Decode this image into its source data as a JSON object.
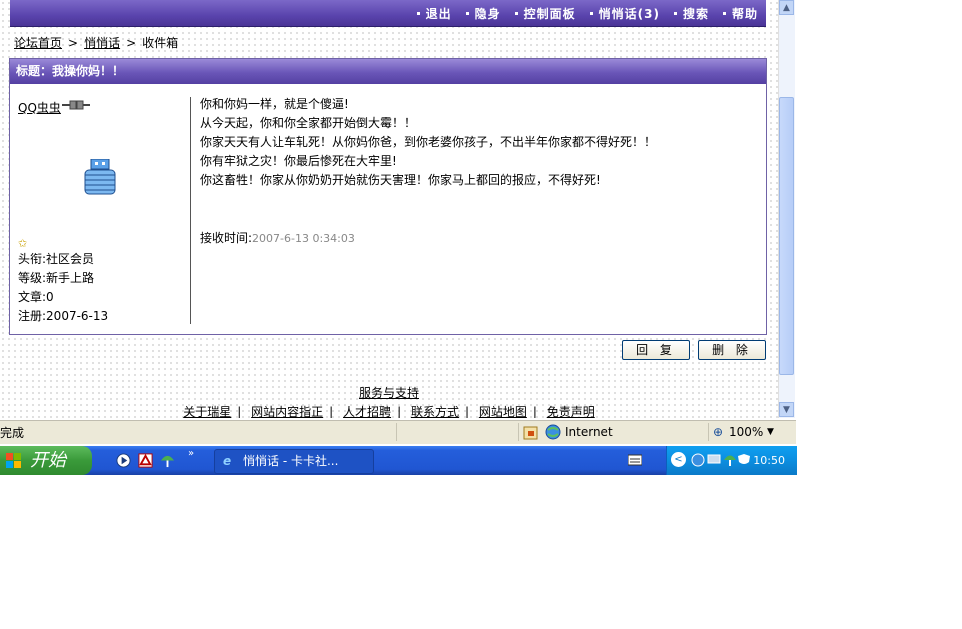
{
  "topnav": {
    "items": [
      "退出",
      "隐身",
      "控制面板",
      "悄悄话(3)",
      "搜索",
      "帮助"
    ]
  },
  "breadcrumb": {
    "home": "论坛首页",
    "whisper": "悄悄话",
    "inbox": "收件箱"
  },
  "message": {
    "title": "标题：我操你妈！！",
    "author": "QQ虫虫",
    "rank_title": "头衔:社区会员",
    "level": "等级:新手上路",
    "posts": "文章:0",
    "registered": "注册:2007-6-13",
    "lines": [
      "你和你妈一样，就是个傻逼!",
      "从今天起，你和你全家都开始倒大霉！！",
      "你家天天有人让车轧死！从你妈你爸，到你老婆你孩子，不出半年你家都不得好死！！",
      "你有牢狱之灾！你最后惨死在大牢里!",
      "你这畜牲！你家从你奶奶开始就伤天害理！你家马上都回的报应，不得好死!"
    ],
    "received_label": "接收时间:",
    "received_time": "2007-6-13 0:34:03"
  },
  "buttons": {
    "reply": "回 复",
    "delete": "删 除"
  },
  "footer": {
    "heading": "服务与支持",
    "links": [
      "关于瑞星",
      "网站内容指正",
      "人才招聘",
      "联系方式",
      "网站地图",
      "免责声明"
    ]
  },
  "statusbar": {
    "status": "完成",
    "zone": "Internet",
    "zoom": "100%"
  },
  "taskbar": {
    "start": "开始",
    "task": "悄悄话 - 卡卡社...",
    "clock": "10:50"
  },
  "colors": {
    "nav_purple": "#5a44ad",
    "xp_blue": "#245edb",
    "start_green": "#3a9a3a"
  }
}
